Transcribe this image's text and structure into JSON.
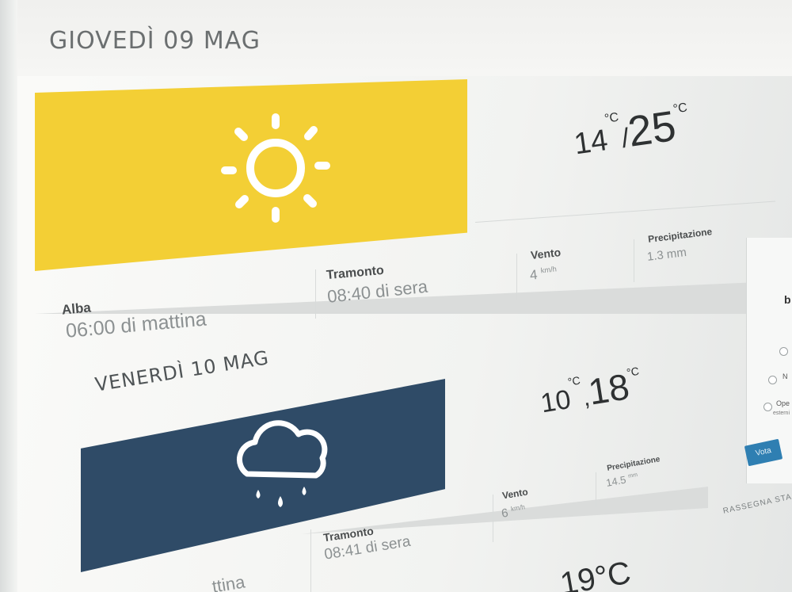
{
  "days": [
    {
      "title": "GIOVEDÌ 09 MAG",
      "icon": "sun-icon",
      "card_color": "#f4d138",
      "temp_low": "14",
      "temp_high": "25",
      "temp_unit": "°C",
      "sunrise_label": "Alba",
      "sunrise_value": "06:00 di mattina",
      "sunset_label": "Tramonto",
      "sunset_value": "08:40 di sera",
      "wind_label": "Vento",
      "wind_value": "4",
      "wind_unit": "km/h",
      "precip_label": "Precipitazione",
      "precip_value": "1.3 mm"
    },
    {
      "title": "VENERDÌ 10 MAG",
      "icon": "rain-cloud-icon",
      "card_color": "#2f4a66",
      "temp_low": "10",
      "temp_high": "18",
      "temp_unit": "°C",
      "sunrise_partial": "ttina",
      "sunset_label": "Tramonto",
      "sunset_value": "08:41 di sera",
      "wind_label": "Vento",
      "wind_value": "6",
      "wind_unit": "km/h",
      "precip_label": "Precipitazione",
      "precip_value": "14.5",
      "precip_unit": "mm"
    }
  ],
  "next_day_partial_temp": "19°C",
  "sidebar": {
    "letter": "b",
    "options": [
      "N",
      "N",
      "Ope"
    ],
    "option_extra": "esterni",
    "vote_label": "Vota",
    "section_label": "RASSEGNA STA"
  }
}
